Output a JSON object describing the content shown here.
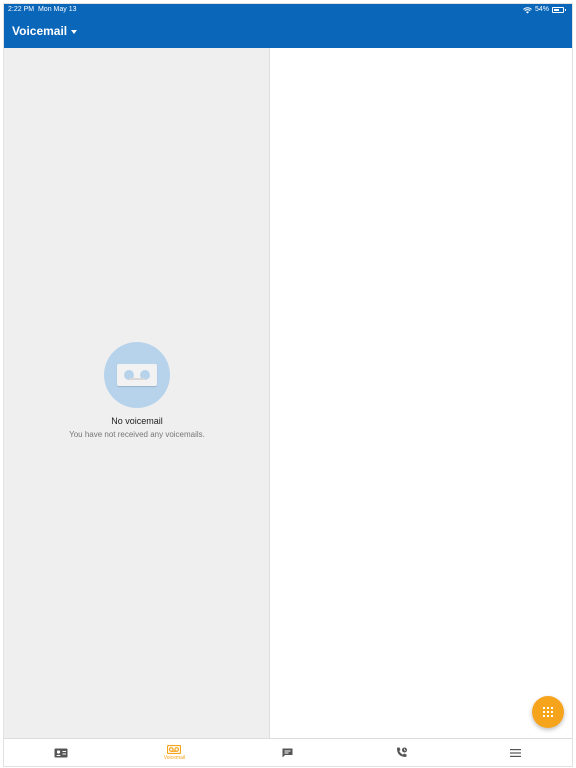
{
  "status_bar": {
    "time": "2:22 PM",
    "date": "Mon May 13",
    "battery": "54%",
    "battery_level": 0.54
  },
  "header": {
    "title": "Voicemail"
  },
  "empty_state": {
    "title": "No voicemail",
    "subtitle": "You have not received any voicemails."
  },
  "tab_bar": {
    "tabs": [
      {
        "icon": "contacts-icon",
        "label": ""
      },
      {
        "icon": "voicemail-icon",
        "label": "Voicemail",
        "active": true
      },
      {
        "icon": "chat-icon",
        "label": ""
      },
      {
        "icon": "call-history-icon",
        "label": ""
      },
      {
        "icon": "menu-icon",
        "label": ""
      }
    ]
  },
  "fab": {
    "icon": "dialpad-icon"
  },
  "colors": {
    "primary": "#0a66b9",
    "accent": "#f7a41d",
    "list_bg": "#efefef",
    "illustration": "#b7d3ec"
  }
}
